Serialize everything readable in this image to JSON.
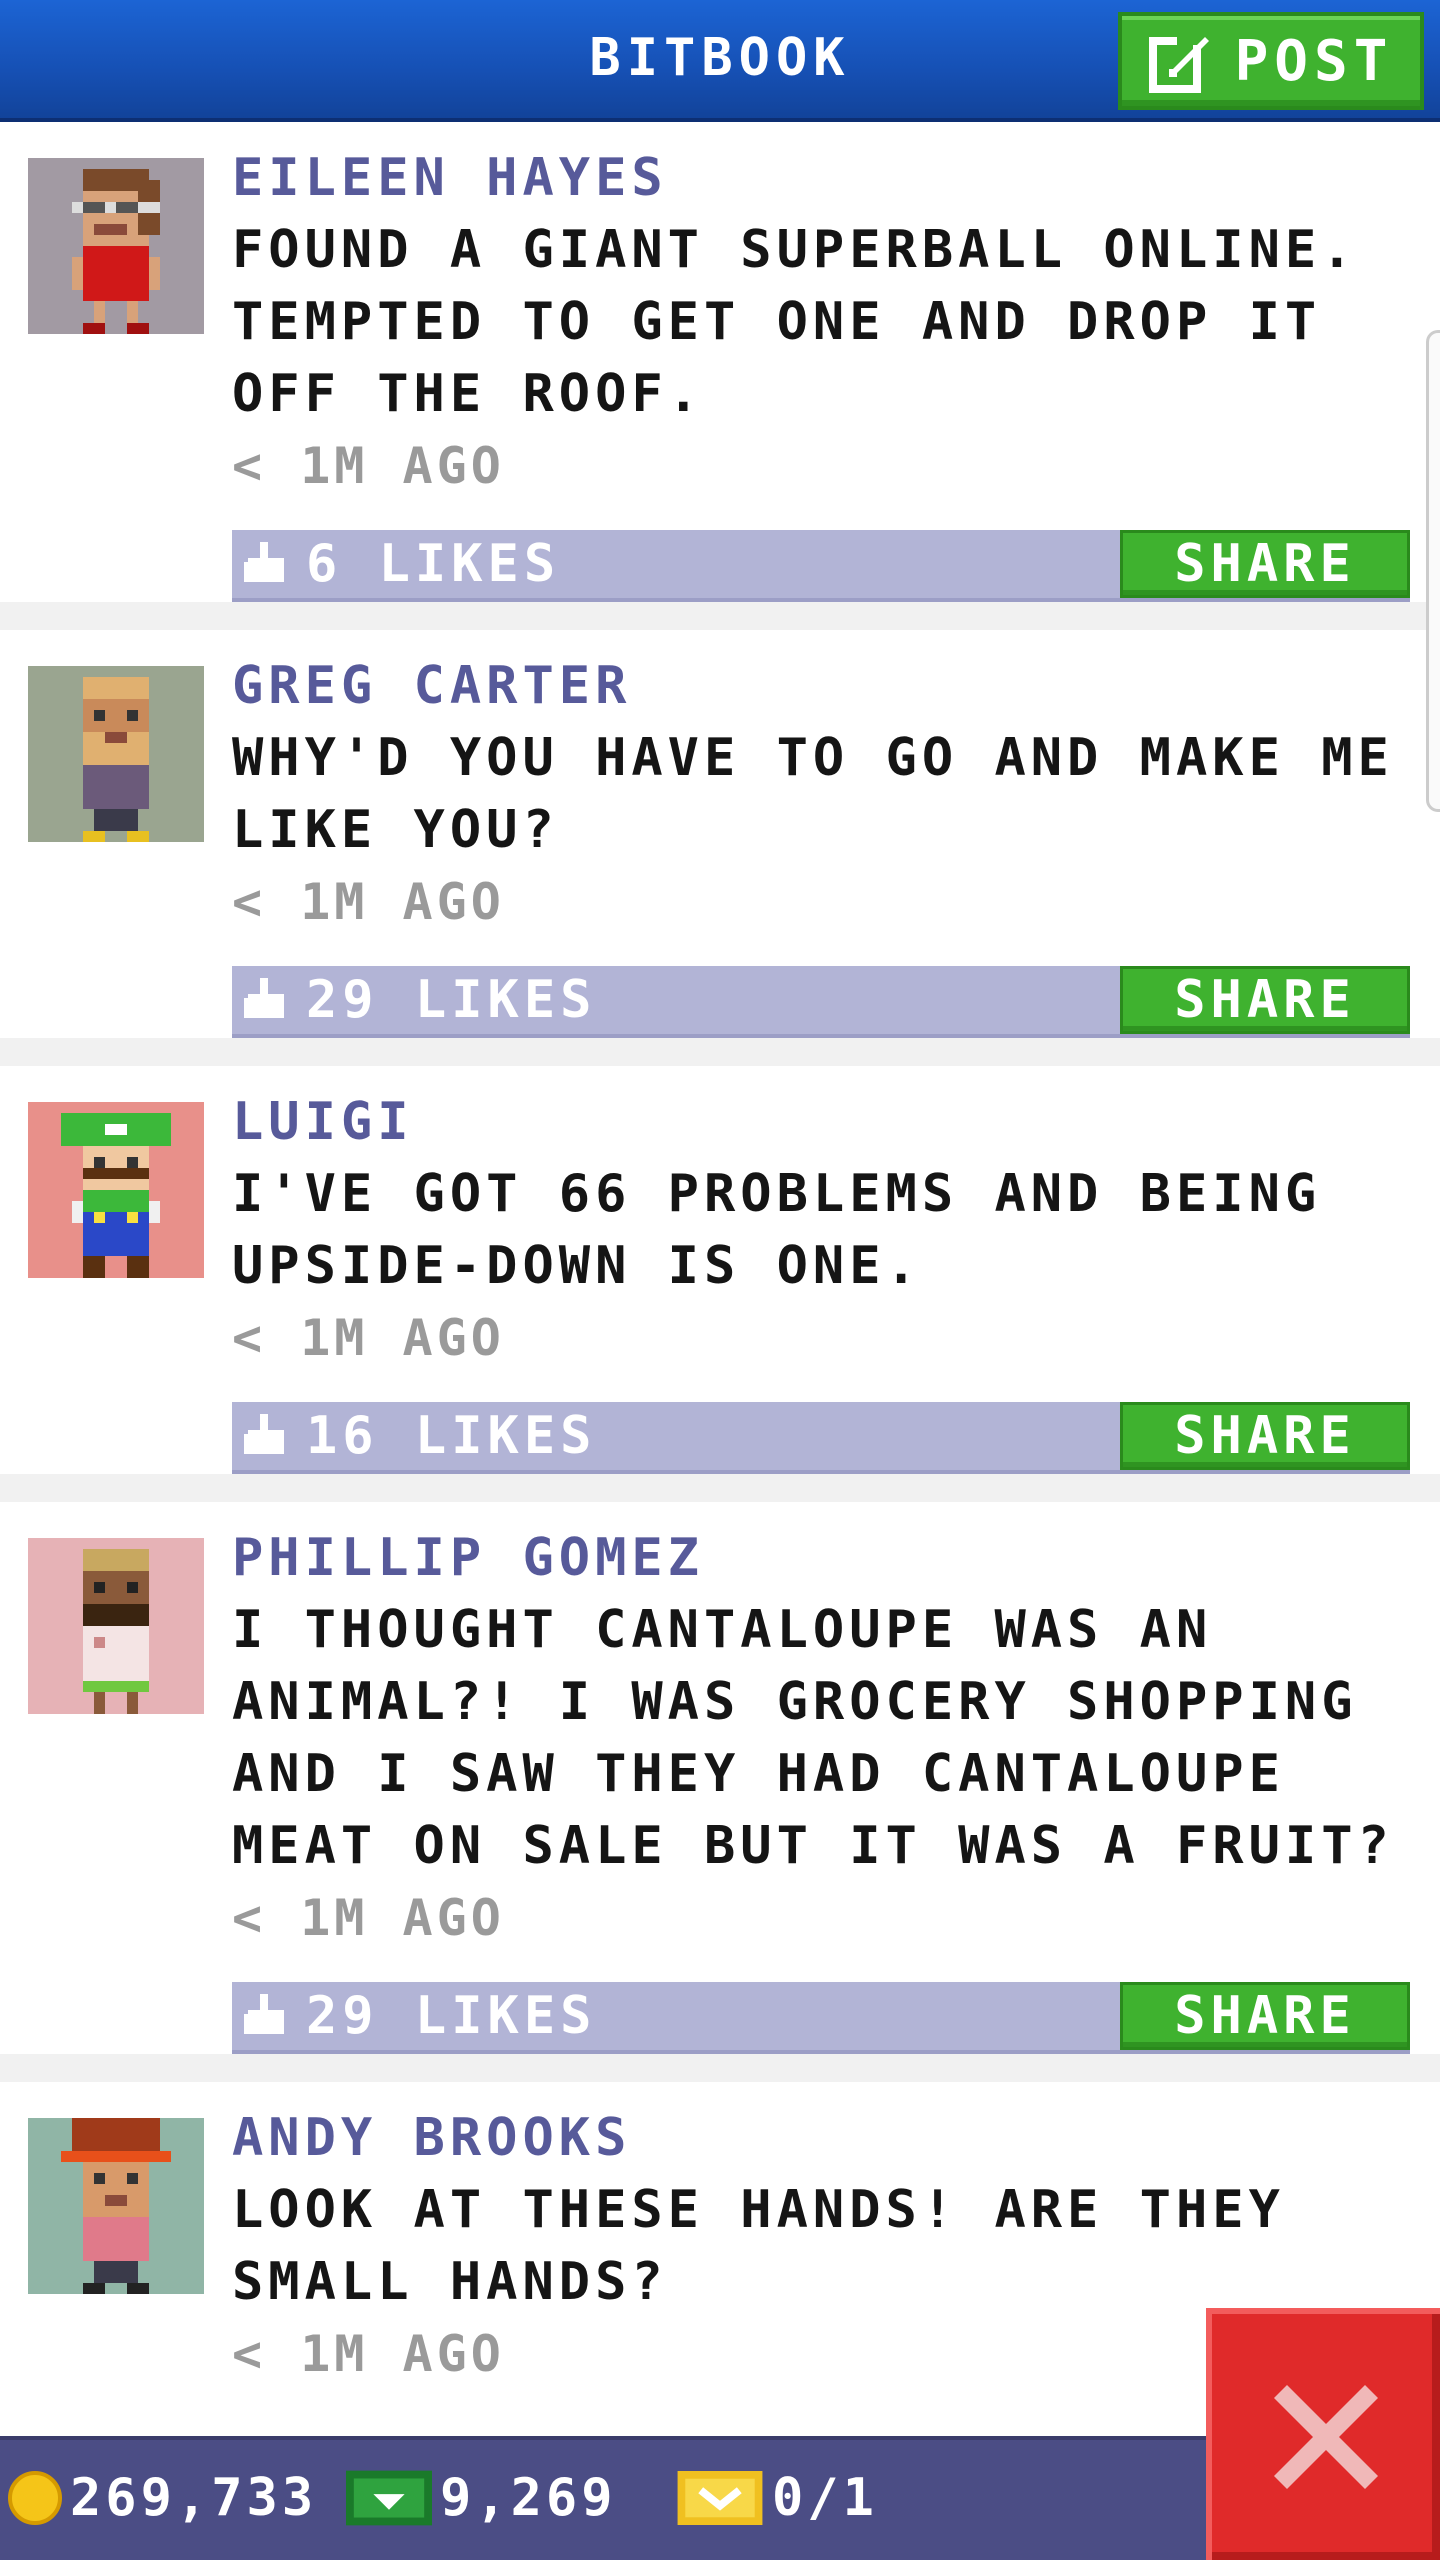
{
  "header": {
    "title": "BITBOOK",
    "post_label": "POST"
  },
  "posts": [
    {
      "author": "EILEEN HAYES",
      "text": "FOUND A GIANT SUPERBALL ONLINE. TEMPTED TO GET ONE AND DROP IT OFF THE ROOF.",
      "time": "< 1M AGO",
      "likes": "6 LIKES",
      "share_label": "SHARE",
      "avatar_bg": "#a29aa3"
    },
    {
      "author": "GREG CARTER",
      "text": "WHY'D YOU HAVE TO GO AND MAKE ME LIKE YOU?",
      "time": "< 1M AGO",
      "likes": "29 LIKES",
      "share_label": "SHARE",
      "avatar_bg": "#9aa590"
    },
    {
      "author": "LUIGI",
      "text": "I'VE GOT 66 PROBLEMS AND BEING UPSIDE-DOWN IS ONE.",
      "time": "< 1M AGO",
      "likes": "16 LIKES",
      "share_label": "SHARE",
      "avatar_bg": "#e8908a"
    },
    {
      "author": "PHILLIP GOMEZ",
      "text": "I THOUGHT CANTALOUPE WAS AN ANIMAL?! I WAS GROCERY SHOPPING AND I SAW THEY HAD CANTALOUPE MEAT ON SALE BUT IT WAS A FRUIT?",
      "time": "< 1M AGO",
      "likes": "29 LIKES",
      "share_label": "SHARE",
      "avatar_bg": "#e6b2b6"
    },
    {
      "author": "ANDY BROOKS",
      "text": "LOOK AT THESE HANDS! ARE THEY SMALL HANDS?",
      "time": "< 1M AGO",
      "likes": "",
      "share_label": "",
      "avatar_bg": "#90b5a6"
    }
  ],
  "bottom_bar": {
    "coins": "269,733",
    "bux": "9,269",
    "tickets": "0/1"
  },
  "colors": {
    "header_blue": "#1650b4",
    "accent_green": "#3fb22f",
    "author_purple": "#575a9a",
    "like_bar": "#b2b4d6",
    "close_red": "#e02a2a"
  },
  "icons": [
    "edit-icon",
    "thumbs-up-icon",
    "coin-icon",
    "cash-icon",
    "ticket-icon",
    "close-icon"
  ]
}
